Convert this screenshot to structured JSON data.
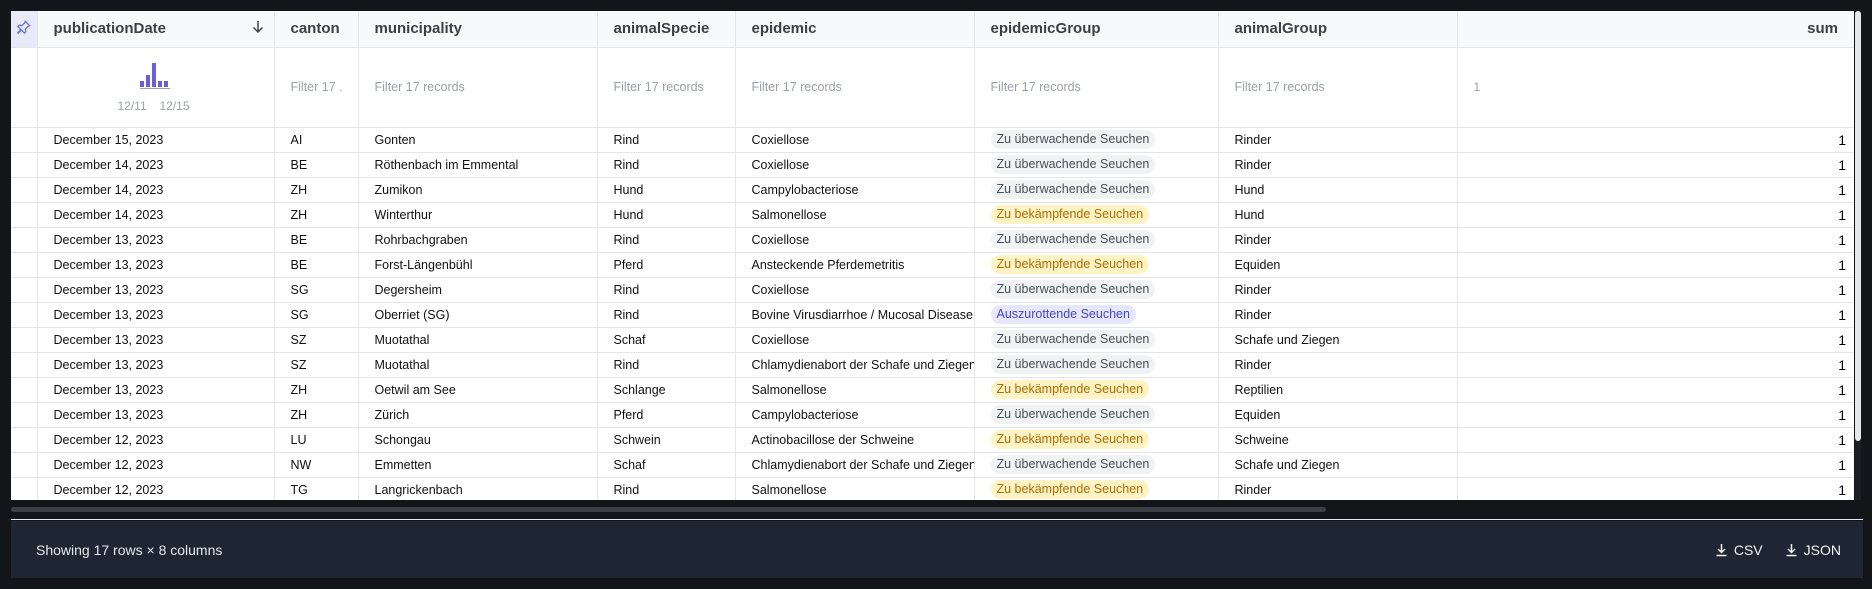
{
  "columns": [
    {
      "key": "publicationDate",
      "label": "publicationDate"
    },
    {
      "key": "canton",
      "label": "canton"
    },
    {
      "key": "municipality",
      "label": "municipality"
    },
    {
      "key": "animalSpecie",
      "label": "animalSpecie"
    },
    {
      "key": "epidemic",
      "label": "epidemic"
    },
    {
      "key": "epidemicGroup",
      "label": "epidemicGroup"
    },
    {
      "key": "animalGroup",
      "label": "animalGroup"
    },
    {
      "key": "sum",
      "label": "sum"
    }
  ],
  "filters": {
    "canton": "Filter 17 ...",
    "municipality": "Filter 17 records",
    "animalSpecie": "Filter 17 records",
    "epidemic": "Filter 17 records",
    "epidemicGroup": "Filter 17 records",
    "animalGroup": "Filter 17 records",
    "sum": "1"
  },
  "histogram": {
    "label_start": "12/11",
    "label_end": "12/15",
    "bars": [
      1,
      2,
      4,
      1,
      1
    ],
    "color": "#6b5fd6"
  },
  "rows": [
    {
      "publicationDate": "December 15, 2023",
      "canton": "AI",
      "municipality": "Gonten",
      "animalSpecie": "Rind",
      "epidemic": "Coxiellose",
      "epidemicGroup": "Zu überwachende Seuchen",
      "tag": "gray",
      "animalGroup": "Rinder",
      "sum": "1"
    },
    {
      "publicationDate": "December 14, 2023",
      "canton": "BE",
      "municipality": "Röthenbach im Emmental",
      "animalSpecie": "Rind",
      "epidemic": "Coxiellose",
      "epidemicGroup": "Zu überwachende Seuchen",
      "tag": "gray",
      "animalGroup": "Rinder",
      "sum": "1"
    },
    {
      "publicationDate": "December 14, 2023",
      "canton": "ZH",
      "municipality": "Zumikon",
      "animalSpecie": "Hund",
      "epidemic": "Campylobacteriose",
      "epidemicGroup": "Zu überwachende Seuchen",
      "tag": "gray",
      "animalGroup": "Hund",
      "sum": "1"
    },
    {
      "publicationDate": "December 14, 2023",
      "canton": "ZH",
      "municipality": "Winterthur",
      "animalSpecie": "Hund",
      "epidemic": "Salmonellose",
      "epidemicGroup": "Zu bekämpfende Seuchen",
      "tag": "yellow",
      "animalGroup": "Hund",
      "sum": "1"
    },
    {
      "publicationDate": "December 13, 2023",
      "canton": "BE",
      "municipality": "Rohrbachgraben",
      "animalSpecie": "Rind",
      "epidemic": "Coxiellose",
      "epidemicGroup": "Zu überwachende Seuchen",
      "tag": "gray",
      "animalGroup": "Rinder",
      "sum": "1"
    },
    {
      "publicationDate": "December 13, 2023",
      "canton": "BE",
      "municipality": "Forst-Längenbühl",
      "animalSpecie": "Pferd",
      "epidemic": "Ansteckende Pferdemetritis",
      "epidemicGroup": "Zu bekämpfende Seuchen",
      "tag": "yellow",
      "animalGroup": "Equiden",
      "sum": "1"
    },
    {
      "publicationDate": "December 13, 2023",
      "canton": "SG",
      "municipality": "Degersheim",
      "animalSpecie": "Rind",
      "epidemic": "Coxiellose",
      "epidemicGroup": "Zu überwachende Seuchen",
      "tag": "gray",
      "animalGroup": "Rinder",
      "sum": "1"
    },
    {
      "publicationDate": "December 13, 2023",
      "canton": "SG",
      "municipality": "Oberriet (SG)",
      "animalSpecie": "Rind",
      "epidemic": "Bovine Virusdiarrhoe / Mucosal Disease",
      "epidemicGroup": "Auszurottende Seuchen",
      "tag": "purple",
      "animalGroup": "Rinder",
      "sum": "1"
    },
    {
      "publicationDate": "December 13, 2023",
      "canton": "SZ",
      "municipality": "Muotathal",
      "animalSpecie": "Schaf",
      "epidemic": "Coxiellose",
      "epidemicGroup": "Zu überwachende Seuchen",
      "tag": "gray",
      "animalGroup": "Schafe und Ziegen",
      "sum": "1"
    },
    {
      "publicationDate": "December 13, 2023",
      "canton": "SZ",
      "municipality": "Muotathal",
      "animalSpecie": "Rind",
      "epidemic": "Chlamydienabort der Schafe und Ziegen",
      "epidemicGroup": "Zu überwachende Seuchen",
      "tag": "gray",
      "animalGroup": "Rinder",
      "sum": "1"
    },
    {
      "publicationDate": "December 13, 2023",
      "canton": "ZH",
      "municipality": "Oetwil am See",
      "animalSpecie": "Schlange",
      "epidemic": "Salmonellose",
      "epidemicGroup": "Zu bekämpfende Seuchen",
      "tag": "yellow",
      "animalGroup": "Reptilien",
      "sum": "1"
    },
    {
      "publicationDate": "December 13, 2023",
      "canton": "ZH",
      "municipality": "Zürich",
      "animalSpecie": "Pferd",
      "epidemic": "Campylobacteriose",
      "epidemicGroup": "Zu überwachende Seuchen",
      "tag": "gray",
      "animalGroup": "Equiden",
      "sum": "1"
    },
    {
      "publicationDate": "December 12, 2023",
      "canton": "LU",
      "municipality": "Schongau",
      "animalSpecie": "Schwein",
      "epidemic": "Actinobacillose der Schweine",
      "epidemicGroup": "Zu bekämpfende Seuchen",
      "tag": "yellow",
      "animalGroup": "Schweine",
      "sum": "1"
    },
    {
      "publicationDate": "December 12, 2023",
      "canton": "NW",
      "municipality": "Emmetten",
      "animalSpecie": "Schaf",
      "epidemic": "Chlamydienabort der Schafe und Ziegen",
      "epidemicGroup": "Zu überwachende Seuchen",
      "tag": "gray",
      "animalGroup": "Schafe und Ziegen",
      "sum": "1"
    },
    {
      "publicationDate": "December 12, 2023",
      "canton": "TG",
      "municipality": "Langrickenbach",
      "animalSpecie": "Rind",
      "epidemic": "Salmonellose",
      "epidemicGroup": "Zu bekämpfende Seuchen",
      "tag": "yellow",
      "animalGroup": "Rinder",
      "sum": "1"
    }
  ],
  "footer": {
    "status": "Showing 17 rows × 8 columns",
    "csv_label": "CSV",
    "json_label": "JSON"
  },
  "icons": {
    "pin": "pin-icon",
    "sort": "arrow-down-icon",
    "download": "download-icon"
  },
  "colors": {
    "accent": "#6b5fd6",
    "tag_gray_bg": "#f1f2f4",
    "tag_yellow_bg": "#fdf3c4",
    "tag_purple_bg": "#e7e7fc",
    "footer_bg": "#1e2633"
  }
}
